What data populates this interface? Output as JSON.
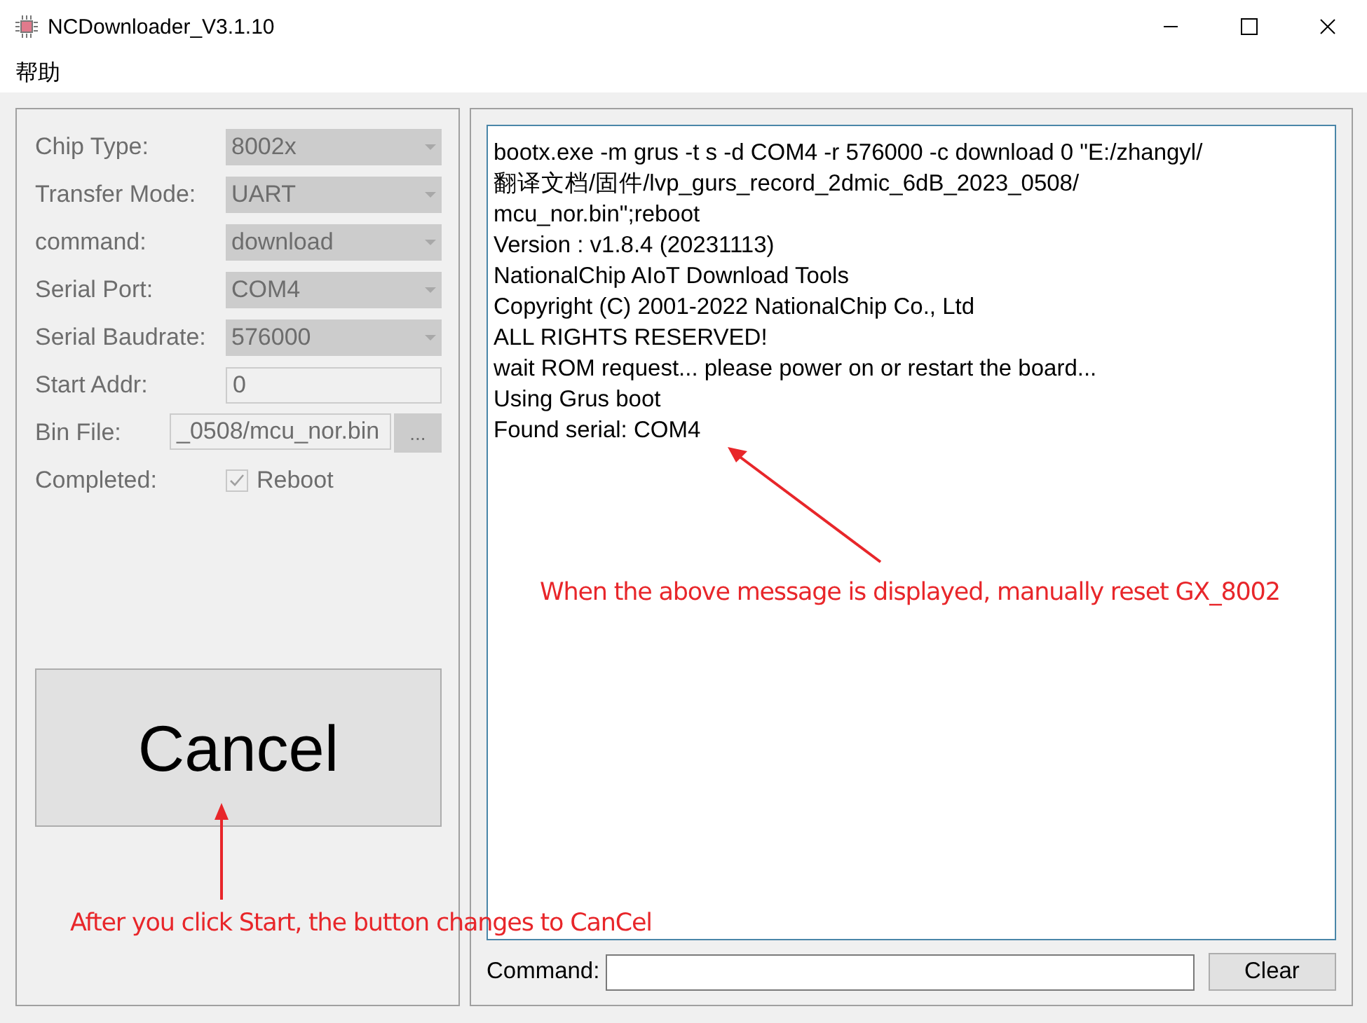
{
  "window": {
    "title": "NCDownloader_V3.1.10"
  },
  "menu": [
    {
      "label": "帮助"
    }
  ],
  "settings": [
    {
      "label": "Chip Type:",
      "kind": "combo",
      "value": "8002x",
      "disabled": true
    },
    {
      "label": "Transfer Mode:",
      "kind": "combo",
      "value": "UART",
      "disabled": true
    },
    {
      "label": "command:",
      "kind": "combo",
      "value": "download",
      "disabled": true
    },
    {
      "label": "Serial Port:",
      "kind": "combo",
      "value": "COM4",
      "disabled": true
    },
    {
      "label": "Serial Baudrate:",
      "kind": "combo",
      "value": "576000",
      "disabled": true
    },
    {
      "label": "Start Addr:",
      "kind": "field",
      "value": "0",
      "disabled": true
    },
    {
      "label": "Bin File:",
      "kind": "file",
      "value": "_0508/mcu_nor.bin",
      "browse": "...",
      "disabled": true
    },
    {
      "label": "Completed:",
      "kind": "checkbox",
      "value": "Reboot",
      "checked": true,
      "disabled": true
    }
  ],
  "action_button": {
    "label": "Cancel"
  },
  "log": [
    "bootx.exe -m  grus  -t  s  -d  COM4  -r  576000  -c  download 0 \"E:/zhangyl/",
    "翻译文档/固件/lvp_gurs_record_2dmic_6dB_2023_0508/",
    "mcu_nor.bin\";reboot",
    "Version : v1.8.4 (20231113)",
    "NationalChip AIoT Download Tools",
    "Copyright (C) 2001-2022 NationalChip Co., Ltd",
    "ALL RIGHTS RESERVED!",
    "wait ROM request... please power on or restart the board...",
    "Using Grus boot",
    "Found serial: COM4"
  ],
  "command": {
    "label": "Command:",
    "clear": "Clear"
  },
  "annotations": [
    {
      "text": "When the above message is displayed, manually reset GX_8002"
    },
    {
      "text": "After you click Start, the button changes to CanCel"
    }
  ]
}
